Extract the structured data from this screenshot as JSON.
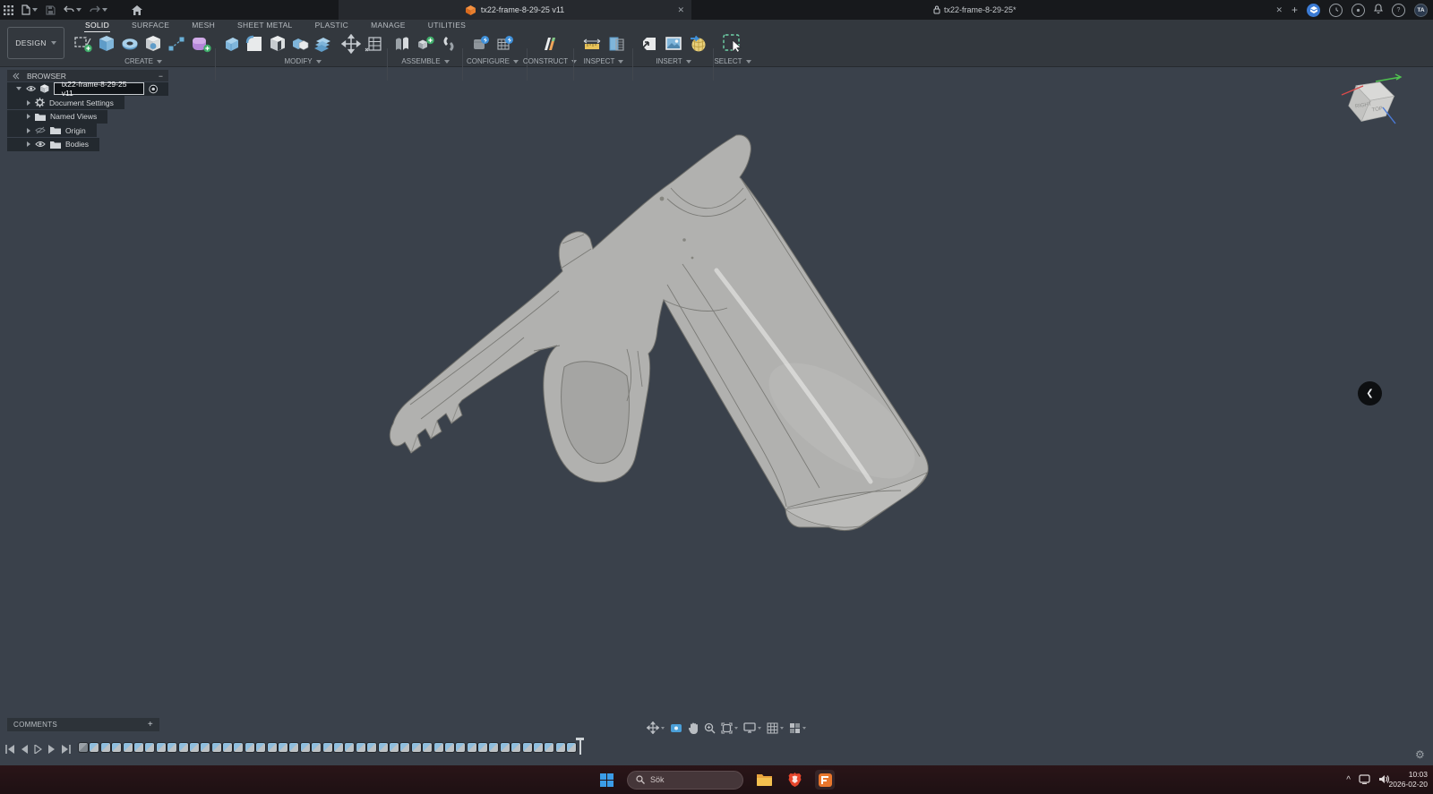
{
  "titlebar": {
    "document_tab_title": "tx22-frame-8-29-25 v11",
    "window_title": "tx22-frame-8-29-25*",
    "avatar_initials": "TA",
    "help_glyph": "?",
    "close_glyph": "✕",
    "new_tab_glyph": "+"
  },
  "ribbon": {
    "design_button_label": "DESIGN",
    "tabs": [
      "SOLID",
      "SURFACE",
      "MESH",
      "SHEET METAL",
      "PLASTIC",
      "MANAGE",
      "UTILITIES"
    ],
    "active_tab": "SOLID",
    "groups": [
      "CREATE",
      "MODIFY",
      "ASSEMBLE",
      "CONFIGURE",
      "CONSTRUCT",
      "INSPECT",
      "INSERT",
      "SELECT"
    ]
  },
  "browser_panel": {
    "title": "BROWSER",
    "collapse_glyph": "−",
    "root_item_label": "tx22-frame-8-29-25 v11",
    "items": [
      {
        "label": "Document Settings",
        "icon": "gear-icon"
      },
      {
        "label": "Named Views",
        "icon": "folder-icon"
      },
      {
        "label": "Origin",
        "icon": "folder-icon",
        "visibility": "off"
      },
      {
        "label": "Bodies",
        "icon": "folder-icon",
        "visibility": "on"
      }
    ]
  },
  "viewcube": {
    "labels": [
      "RIGHT",
      "TOP"
    ]
  },
  "comments_bar": {
    "label": "COMMENTS",
    "add_glyph": "+"
  },
  "view_navbar": {
    "icons": [
      "orbit",
      "look-at",
      "pan",
      "zoom",
      "fit-view",
      "display-settings",
      "grid-and-snaps",
      "viewports"
    ]
  },
  "timeline": {
    "feature_count": 45,
    "playback_controls": [
      "go-to-start",
      "step-back",
      "play",
      "step-forward",
      "go-to-end"
    ]
  },
  "statusbar": {
    "settings_glyph": "⚙",
    "panel_toggle_glyph": "❮"
  },
  "taskbar": {
    "search_placeholder": "Sök",
    "time": "10:03",
    "date": "2026-02-20",
    "tray_chevron_glyph": "^"
  },
  "colors": {
    "canvas_bg": "#3a414b",
    "ribbon_bg": "#33383e",
    "titlebar_bg": "#17191c",
    "taskbar_bg": "#251317",
    "accent_blue": "#7fb5da",
    "model_gray": "#b1b1af",
    "select_dashed_green": "#6fd3a8",
    "fusion_orange": "#e8762c"
  }
}
